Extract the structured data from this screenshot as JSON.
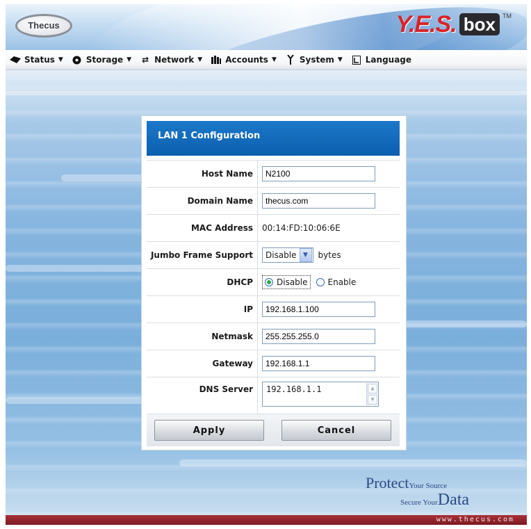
{
  "header": {
    "brand_left": "Thecus",
    "brand_right_yes": "Y.E.S.",
    "brand_right_box": "box",
    "brand_tm": "TM"
  },
  "menu": [
    {
      "label": "Status",
      "icon": "status-icon"
    },
    {
      "label": "Storage",
      "icon": "storage-icon"
    },
    {
      "label": "Network",
      "icon": "network-icon"
    },
    {
      "label": "Accounts",
      "icon": "accounts-icon"
    },
    {
      "label": "System",
      "icon": "system-icon"
    },
    {
      "label": "Language",
      "icon": "language-icon"
    }
  ],
  "dialog": {
    "title": "LAN 1 Configuration",
    "host_name": {
      "label": "Host Name",
      "value": "N2100"
    },
    "domain_name": {
      "label": "Domain Name",
      "value": "thecus.com"
    },
    "mac": {
      "label": "MAC Address",
      "value": "00:14:FD:10:06:6E"
    },
    "jumbo": {
      "label": "Jumbo Frame Support",
      "value": "Disable",
      "unit": "bytes"
    },
    "dhcp": {
      "label": "DHCP",
      "option_disable": "Disable",
      "option_enable": "Enable",
      "selected": "Disable"
    },
    "ip": {
      "label": "IP",
      "value": "192.168.1.100"
    },
    "netmask": {
      "label": "Netmask",
      "value": "255.255.255.0"
    },
    "gateway": {
      "label": "Gateway",
      "value": "192.168.1.1"
    },
    "dns": {
      "label": "DNS Server",
      "value": "192.168.1.1"
    },
    "apply_label": "Apply",
    "cancel_label": "Cancel"
  },
  "footer": {
    "tag_protect": "Protect",
    "tag_your_source": "Your Source",
    "tag_secure_your": "Secure Your",
    "tag_data": "Data",
    "url": "www.thecus.com"
  },
  "colors": {
    "title_bar": "#0b5fae",
    "footer_bar": "#7c1a22",
    "brand_red": "#d8242a"
  }
}
